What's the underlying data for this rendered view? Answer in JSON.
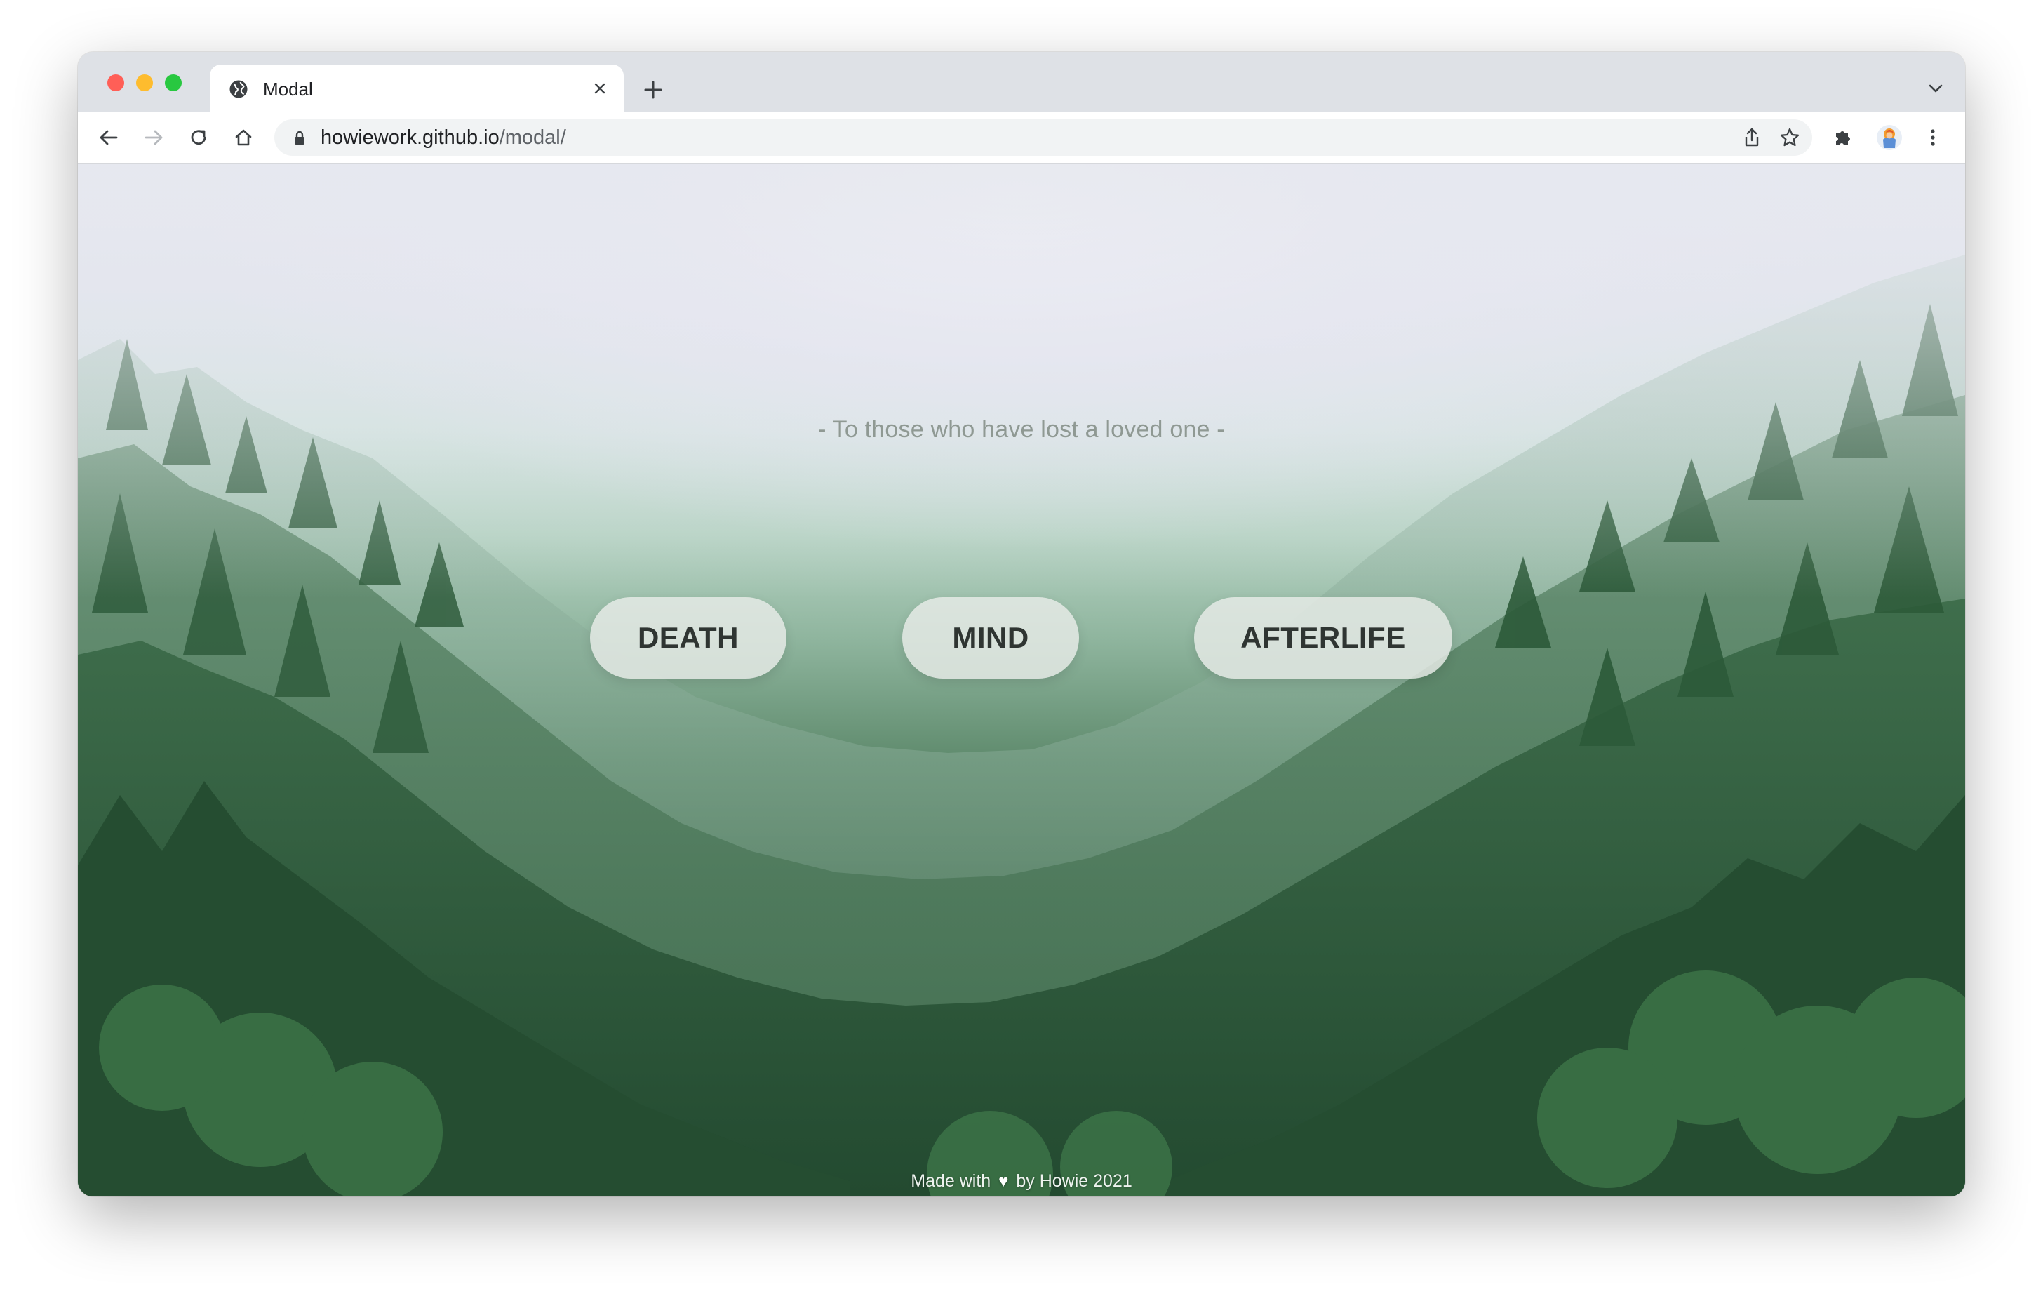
{
  "browser": {
    "tab": {
      "title": "Modal",
      "favicon": "globe-icon"
    },
    "toolbar": {
      "back": "arrow-left-icon",
      "forward": "arrow-right-icon",
      "reload": "reload-icon",
      "home": "home-icon"
    },
    "address": {
      "host": "howiework.github.io",
      "path": "/modal/",
      "lock": "lock-icon"
    }
  },
  "page": {
    "subtitle": "- To those who have lost a loved one -",
    "buttons": [
      {
        "label": "DEATH"
      },
      {
        "label": "MIND"
      },
      {
        "label": "AFTERLIFE"
      }
    ],
    "footer": {
      "before": "Made with",
      "heart": "♥",
      "after": "by Howie 2021"
    }
  },
  "colors": {
    "button_text": "#2f3532",
    "subtitle": "#8f9993",
    "forest_dark": "#2d5a3a",
    "mist": "#e8e6f2"
  }
}
